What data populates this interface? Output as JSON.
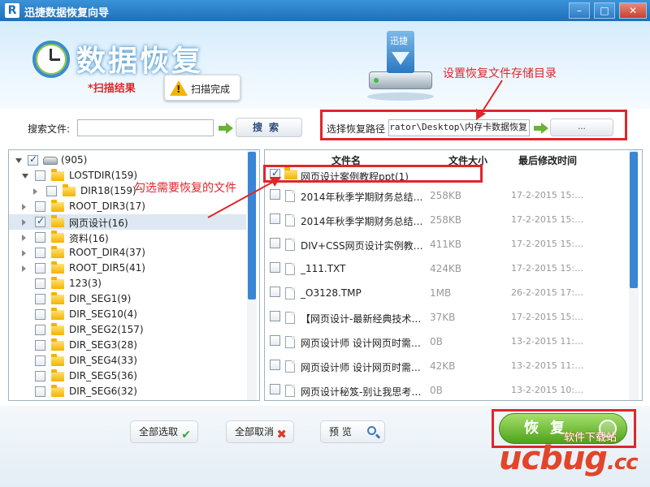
{
  "window": {
    "title": "迅捷数据恢复向导",
    "logo_letter": "R",
    "min": "–",
    "max": "□",
    "close": "✕"
  },
  "header": {
    "brand": "数据恢复",
    "scan_title": "*扫描结果",
    "scan_status": "扫描完成",
    "disk_label": "迅捷"
  },
  "annotations": {
    "set_dir": "设置恢复文件存储目录",
    "check_files": "勾选需要恢复的文件"
  },
  "search": {
    "label": "搜索文件:",
    "value": "",
    "button": "搜索"
  },
  "path": {
    "label": "选择恢复路径",
    "value": "Administrator\\Desktop\\内存卡数据恢复",
    "browse": "..."
  },
  "tree": {
    "root": {
      "label": "(905)",
      "checked": true
    },
    "items": [
      {
        "label": "LOSTDIR(159)",
        "checked": false
      },
      {
        "label": "DIR18(159)",
        "checked": false
      },
      {
        "label": "ROOT_DIR3(17)",
        "checked": false
      },
      {
        "label": "网页设计(16)",
        "checked": true
      },
      {
        "label": "资料(16)",
        "checked": false
      },
      {
        "label": "ROOT_DIR4(37)",
        "checked": false
      },
      {
        "label": "ROOT_DIR5(41)",
        "checked": false
      },
      {
        "label": "123(3)",
        "checked": false
      },
      {
        "label": "DIR_SEG1(9)",
        "checked": false
      },
      {
        "label": "DIR_SEG10(4)",
        "checked": false
      },
      {
        "label": "DIR_SEG2(157)",
        "checked": false
      },
      {
        "label": "DIR_SEG3(28)",
        "checked": false
      },
      {
        "label": "DIR_SEG4(33)",
        "checked": false
      },
      {
        "label": "DIR_SEG5(36)",
        "checked": false
      },
      {
        "label": "DIR_SEG6(32)",
        "checked": false
      }
    ]
  },
  "files": {
    "columns": {
      "name": "文件名",
      "size": "文件大小",
      "modified": "最后修改时间"
    },
    "rows": [
      {
        "name": "网页设计案例教程ppt(1)",
        "size": "",
        "date": "",
        "folder": true,
        "checked": true
      },
      {
        "name": "2014年秋季学期财务总结…",
        "size": "258KB",
        "date": "17-2-2015 15:…",
        "checked": false
      },
      {
        "name": "2014年秋季学期财务总结…",
        "size": "258KB",
        "date": "17-2-2015 15:…",
        "checked": false
      },
      {
        "name": "DIV+CSS网页设计实例教…",
        "size": "411KB",
        "date": "17-2-2015 15:…",
        "checked": false
      },
      {
        "name": "_111.TXT",
        "size": "424KB",
        "date": "17-2-2015 15:…",
        "checked": false
      },
      {
        "name": "_O3128.TMP",
        "size": "1MB",
        "date": "26-2-2015 17:…",
        "checked": false
      },
      {
        "name": "【网页设计-最新经典技术…",
        "size": "37KB",
        "date": "17-2-2015 15:…",
        "checked": false
      },
      {
        "name": "网页设计师 设计网页时需…",
        "size": "0B",
        "date": "13-2-2015 11:…",
        "checked": false
      },
      {
        "name": "网页设计师 设计网页时需…",
        "size": "42KB",
        "date": "13-2-2015 11:…",
        "checked": false
      },
      {
        "name": "网页设计秘笈-别让我思考…",
        "size": "0B",
        "date": "13-2-2015 10:…",
        "checked": false
      }
    ]
  },
  "buttons": {
    "select_all": "全部选取",
    "deselect_all": "全部取消",
    "preview": "预 览",
    "recover": "恢复"
  },
  "watermark": {
    "main": "ucbug",
    "suffix": ".cc",
    "sub": "软件下载站"
  },
  "colors": {
    "accent": "#1f6fb8",
    "annotation": "#e0262b",
    "recover": "#4da21b"
  }
}
